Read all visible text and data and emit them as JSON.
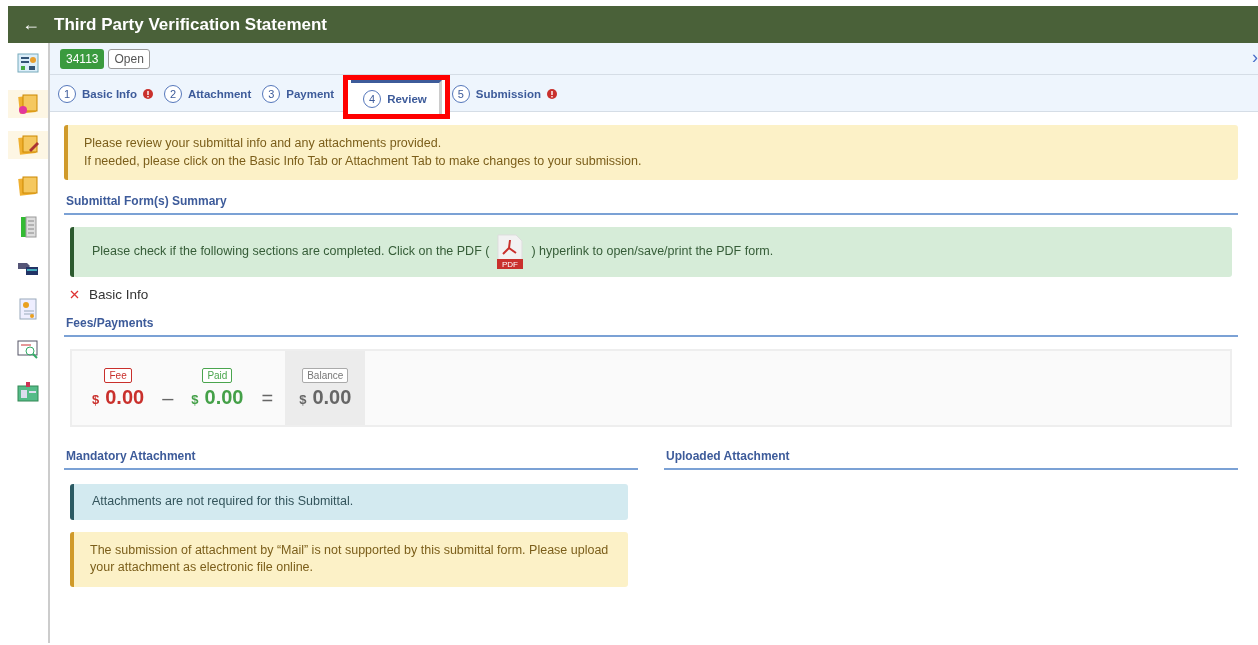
{
  "header": {
    "back_icon": "←",
    "title": "Third Party Verification Statement"
  },
  "record": {
    "id": "34113",
    "status": "Open",
    "next_icon": "›"
  },
  "tabs": [
    {
      "number": "1",
      "label": "Basic Info",
      "selected": false,
      "error": true,
      "highlighted": false
    },
    {
      "number": "2",
      "label": "Attachment",
      "selected": false,
      "error": false,
      "highlighted": false
    },
    {
      "number": "3",
      "label": "Payment",
      "selected": false,
      "error": false,
      "highlighted": false
    },
    {
      "number": "4",
      "label": "Review",
      "selected": true,
      "error": false,
      "highlighted": true
    },
    {
      "number": "5",
      "label": "Submission",
      "selected": false,
      "error": true,
      "highlighted": false
    }
  ],
  "review_notice": [
    "Please review your submittal info and any attachments provided.",
    "If needed, please click on the Basic Info Tab or Attachment Tab to make changes to your submission."
  ],
  "summary": {
    "heading": "Submittal Form(s) Summary",
    "instruction_before": "Please check if the following sections are completed. Click on the PDF (",
    "pdf_label": "PDF",
    "instruction_after": ") hyperlink to open/save/print the PDF form.",
    "sections": [
      {
        "label": "Basic Info",
        "completed": false
      }
    ]
  },
  "fees": {
    "heading": "Fees/Payments",
    "minus": "–",
    "equals": "=",
    "items": [
      {
        "kind": "fee",
        "label": "Fee",
        "currency": "$",
        "amount": "0.00"
      },
      {
        "kind": "paid",
        "label": "Paid",
        "currency": "$",
        "amount": "0.00"
      },
      {
        "kind": "balance",
        "label": "Balance",
        "currency": "$",
        "amount": "0.00"
      }
    ]
  },
  "mandatory_attachment": {
    "heading": "Mandatory Attachment",
    "info": "Attachments are not required for this Submittal.",
    "warning": "The submission of attachment by “Mail” is not supported by this submittal form. Please upload your attachment as electronic file online."
  },
  "uploaded_attachment": {
    "heading": "Uploaded Attachment"
  }
}
